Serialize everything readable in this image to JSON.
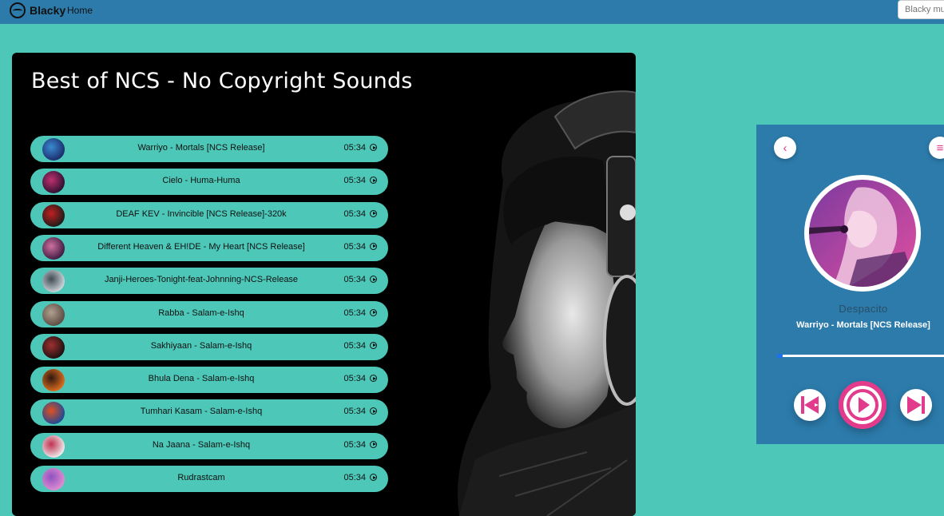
{
  "navbar": {
    "brand": "Blacky",
    "home_link": "Home",
    "search_placeholder": "Blacky music"
  },
  "playlist": {
    "title": "Best of NCS - No Copyright Sounds",
    "songs": [
      {
        "name": "Warriyo - Mortals [NCS Release]",
        "duration": "05:34"
      },
      {
        "name": "Cielo - Huma-Huma",
        "duration": "05:34"
      },
      {
        "name": "DEAF KEV - Invincible [NCS Release]-320k",
        "duration": "05:34"
      },
      {
        "name": "Different Heaven & EH!DE - My Heart [NCS Release]",
        "duration": "05:34"
      },
      {
        "name": "Janji-Heroes-Tonight-feat-Johnning-NCS-Release",
        "duration": "05:34"
      },
      {
        "name": "Rabba - Salam-e-Ishq",
        "duration": "05:34"
      },
      {
        "name": "Sakhiyaan - Salam-e-Ishq",
        "duration": "05:34"
      },
      {
        "name": "Bhula Dena - Salam-e-Ishq",
        "duration": "05:34"
      },
      {
        "name": "Tumhari Kasam - Salam-e-Ishq",
        "duration": "05:34"
      },
      {
        "name": "Na Jaana - Salam-e-Ishq",
        "duration": "05:34"
      },
      {
        "name": "Rudrastcam",
        "duration": "05:34"
      }
    ]
  },
  "player": {
    "album": "Despacito",
    "track": "Warriyo - Mortals [NCS Release]",
    "progress_fraction": 0.03,
    "back_icon": "chevron-left-icon",
    "menu_icon": "menu-icon"
  },
  "colors": {
    "background": "#4cc7b8",
    "navbar": "#2c7bab",
    "accent_pink": "#e23b8c",
    "card": "#000000"
  }
}
